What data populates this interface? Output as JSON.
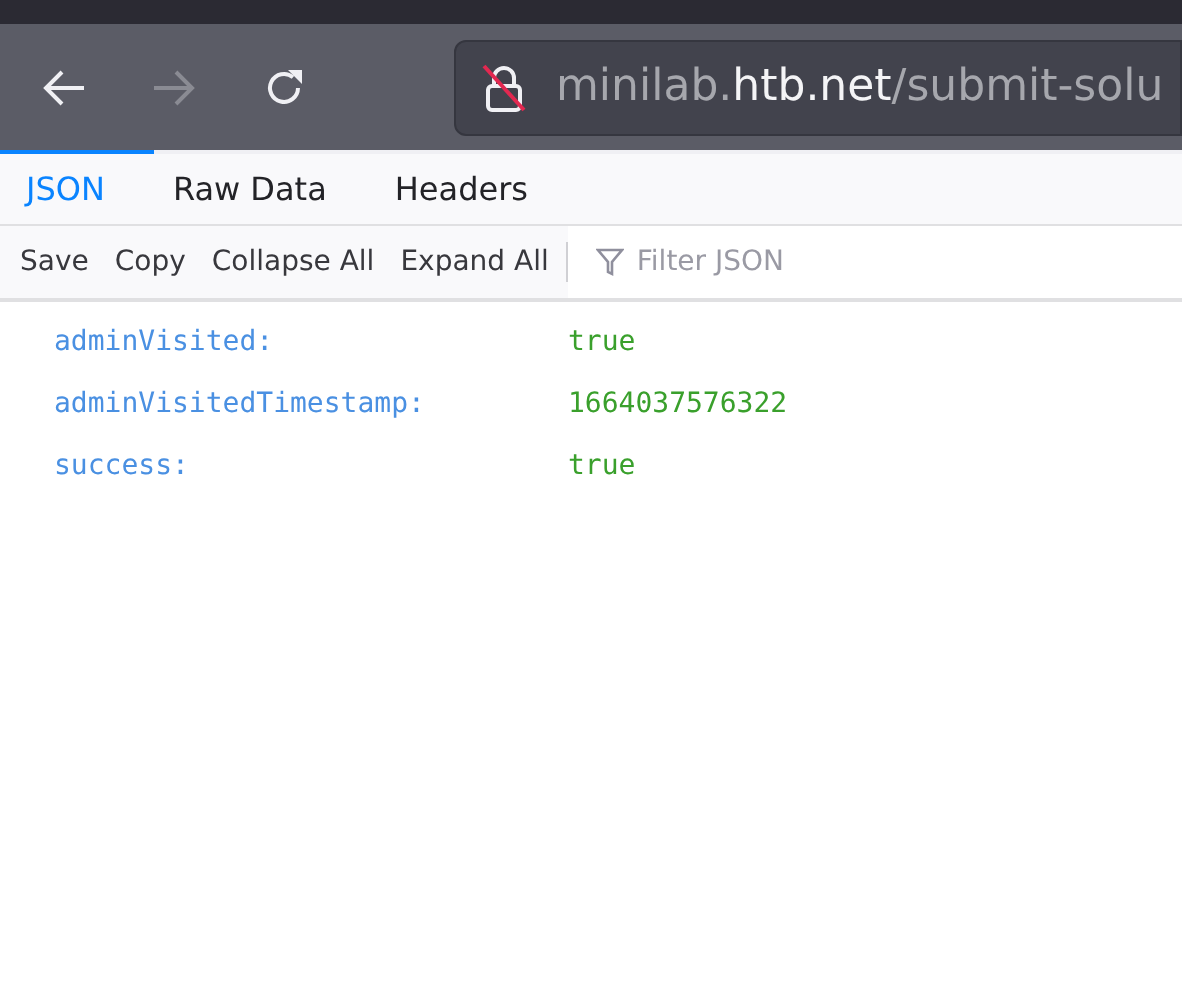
{
  "nav": {
    "back_disabled": false,
    "forward_disabled": true
  },
  "url": {
    "subdomain": "minilab.",
    "domain": "htb.net",
    "path": "/submit-solu"
  },
  "tabs": [
    {
      "label": "JSON",
      "selected": true
    },
    {
      "label": "Raw Data",
      "selected": false
    },
    {
      "label": "Headers",
      "selected": false
    }
  ],
  "toolbar": [
    "Save",
    "Copy",
    "Collapse All",
    "Expand All"
  ],
  "filter": {
    "placeholder": "Filter JSON"
  },
  "rows": [
    {
      "key": "adminVisited:",
      "value": "true"
    },
    {
      "key": "adminVisitedTimestamp:",
      "value": "1664037576322"
    },
    {
      "key": "success:",
      "value": "true"
    }
  ]
}
